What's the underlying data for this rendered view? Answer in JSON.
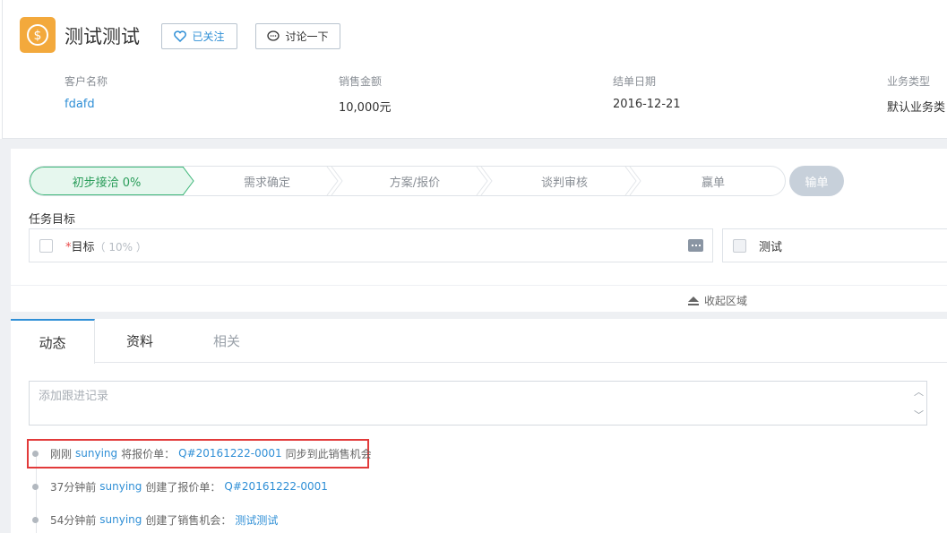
{
  "header": {
    "title": "测试测试",
    "follow_label": "已关注",
    "discuss_label": "讨论一下",
    "fields": [
      {
        "label": "客户名称",
        "value": "fdafd"
      },
      {
        "label": "销售金额",
        "value": "10,000元"
      },
      {
        "label": "结单日期",
        "value": "2016-12-21"
      },
      {
        "label": "业务类型",
        "value": "默认业务类"
      }
    ]
  },
  "stages": {
    "items": [
      "初步接洽 0%",
      "需求确定",
      "方案/报价",
      "谈判审核",
      "赢单"
    ],
    "lose_label": "输单"
  },
  "task": {
    "section_label": "任务目标",
    "required_mark": "*",
    "goal_label": "目标",
    "goal_pct": "（ 10% ）",
    "test_label": "测试",
    "collapse_label": "收起区域"
  },
  "tabs": [
    "动态",
    "资料",
    "相关"
  ],
  "composer": {
    "placeholder": "添加跟进记录"
  },
  "timeline": [
    {
      "time": "刚刚",
      "user": "sunying",
      "action": "将报价单：",
      "link": "Q#20161222-0001",
      "tail": "同步到此销售机会"
    },
    {
      "time": "37分钟前",
      "user": "sunying",
      "action": "创建了报价单：",
      "link": "Q#20161222-0001",
      "tail": ""
    },
    {
      "time": "54分钟前",
      "user": "sunying",
      "action": "创建了销售机会：",
      "link": "测试测试",
      "tail": ""
    }
  ],
  "colors": {
    "accent": "#2f8fd6",
    "stage_active": "#2a9d5a",
    "app_icon": "#f3a93c",
    "highlight": "#e23a3a"
  }
}
